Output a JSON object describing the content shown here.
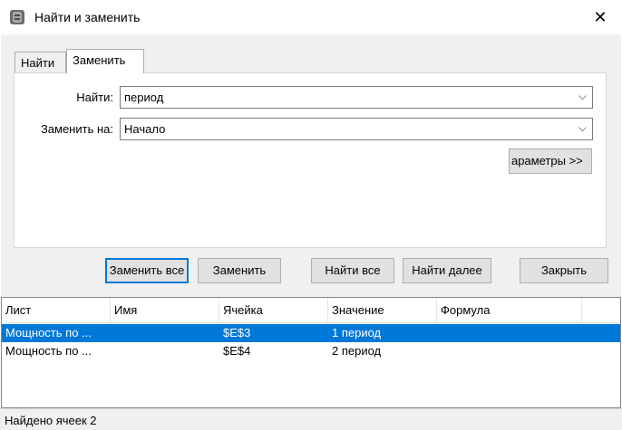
{
  "window": {
    "title": "Найти и заменить"
  },
  "tabs": [
    {
      "label": "Найти"
    },
    {
      "label": "Заменить"
    }
  ],
  "form": {
    "find_label": "Найти:",
    "find_value": "период",
    "replace_label": "Заменить на:",
    "replace_value": "Начало",
    "params_button": "араметры >>"
  },
  "buttons": {
    "replace_all": "Заменить все",
    "replace": "Заменить",
    "find_all": "Найти все",
    "find_next": "Найти далее",
    "close": "Закрыть"
  },
  "results": {
    "columns": [
      "Лист",
      "Имя",
      "Ячейка",
      "Значение",
      "Формула"
    ],
    "rows": [
      {
        "sheet": "Мощность по ...",
        "name": "",
        "cell": "$E$3",
        "value": "1 период",
        "formula": "",
        "selected": true
      },
      {
        "sheet": "Мощность по ...",
        "name": "",
        "cell": "$E$4",
        "value": "2 период",
        "formula": "",
        "selected": false
      }
    ]
  },
  "status": {
    "text": "Найдено ячеек 2"
  },
  "colors": {
    "selection": "#0078d7",
    "face": "#f0f0f0",
    "button": "#e1e1e1"
  }
}
